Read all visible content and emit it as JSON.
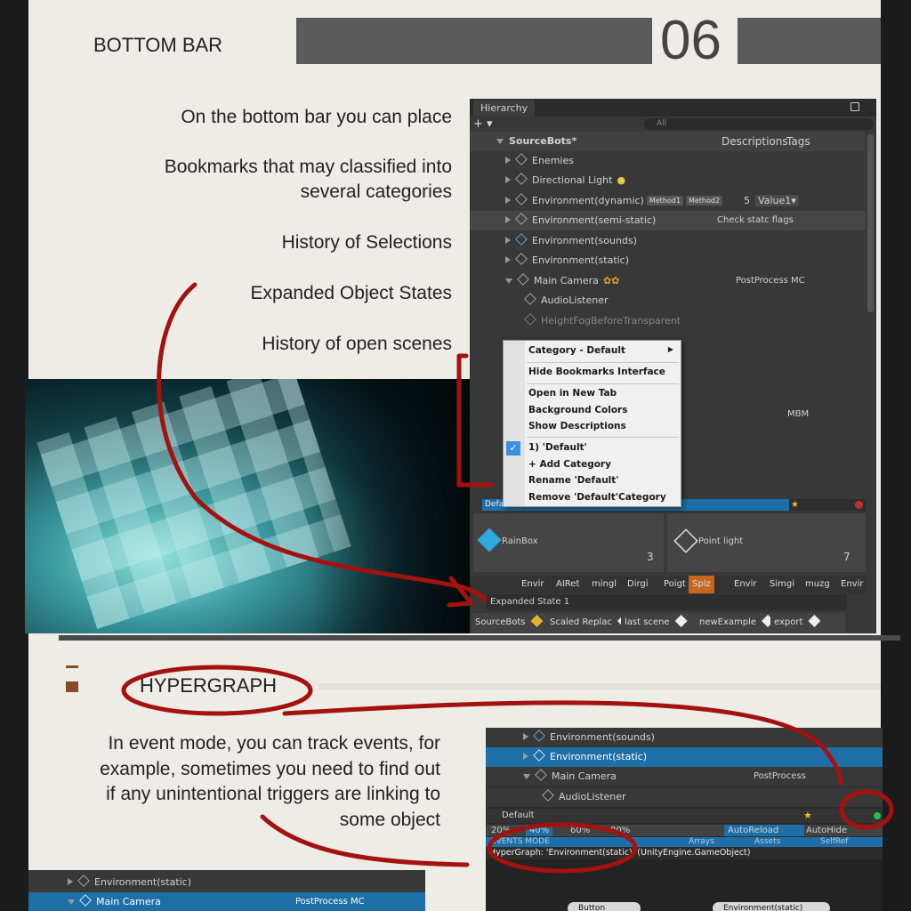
{
  "page": {
    "section_title": "BOTTOM BAR",
    "section_number": "06",
    "features": [
      "On the bottom bar you can place",
      "Bookmarks that may classified into",
      "several categories",
      "History of Selections",
      "Expanded Object States",
      "History of open scenes"
    ],
    "hypergraph_title": "HYPERGRAPH",
    "event_text": [
      "In event mode, you can track events, for",
      "example, sometimes you need to find out",
      "if any unintentional triggers are linking to",
      "some object"
    ]
  },
  "hierarchy": {
    "tab_label": "Hierarchy",
    "add_label": "+ ▾",
    "search_placeholder": "All",
    "scene_name": "SourceBots*",
    "col_descriptions": "Descriptions",
    "col_tags": "Tags",
    "rows": [
      {
        "name": "Enemies"
      },
      {
        "name": "Directional Light"
      },
      {
        "name": "Environment(dynamic)",
        "chips": [
          "Method1",
          "Method2"
        ],
        "value_num": "5",
        "value_sel": "Value1▾"
      },
      {
        "name": "Environment(semi-static)",
        "desc": "Check statc flags"
      },
      {
        "name": "Environment(sounds)"
      },
      {
        "name": "Environment(static)"
      },
      {
        "name": "Main Camera",
        "desc": "PostProcess MC"
      },
      {
        "name": "AudioListener"
      },
      {
        "name": "HeightFogBeforeTransparent"
      },
      {
        "name": "",
        "desc": "MBM"
      }
    ]
  },
  "context_menu": {
    "items": [
      "Category - Default",
      "Hide Bookmarks Interface",
      "Open in New Tab",
      "Background Colors",
      "Show Descriptions",
      "1) 'Default'",
      "+ Add Category",
      "Rename 'Default'",
      "Remove 'Default'Category"
    ]
  },
  "bottom_bar": {
    "category": "Default",
    "bookmarks": [
      {
        "label": "RainBox",
        "count": "3"
      },
      {
        "label": "Point light",
        "count": "7"
      }
    ],
    "history": [
      "Envir",
      "AIRet",
      "mingl",
      "Dirgi",
      "Poigt",
      "Splz",
      "Envir",
      "Simgi",
      "muzg",
      "Envir"
    ],
    "expanded_state": "Expanded State 1",
    "scenes": [
      "SourceBots",
      "Scaled Replac",
      "last scene",
      "newExample",
      "export"
    ]
  },
  "event_panel": {
    "rows": [
      {
        "name": "Environment(sounds)"
      },
      {
        "name": "Environment(static)"
      },
      {
        "name": "Main Camera",
        "desc": "PostProcess"
      },
      {
        "name": "AudioListener"
      }
    ],
    "category": "Default",
    "percents": [
      "20%",
      "40%",
      "60%",
      "80%"
    ],
    "auto_reload": "AutoReload",
    "auto_hide": "AutoHide",
    "events_mode": "EVENTS MODE",
    "arrays": "Arrays",
    "assets": "Assets",
    "selfref": "SelfRef",
    "graph_title": "HyperGraph: 'Environment(static)' (UnityEngine.GameObject)",
    "node_button": "Button",
    "node_env": "Environment(static)"
  },
  "bottom_left": {
    "rows": [
      {
        "name": "Environment(static)"
      },
      {
        "name": "Main Camera",
        "desc": "PostProcess MC"
      }
    ]
  },
  "colors": {
    "accent_blue": "#1e6fa8",
    "annotation_red": "#a3120f",
    "paper": "#eeece6"
  }
}
